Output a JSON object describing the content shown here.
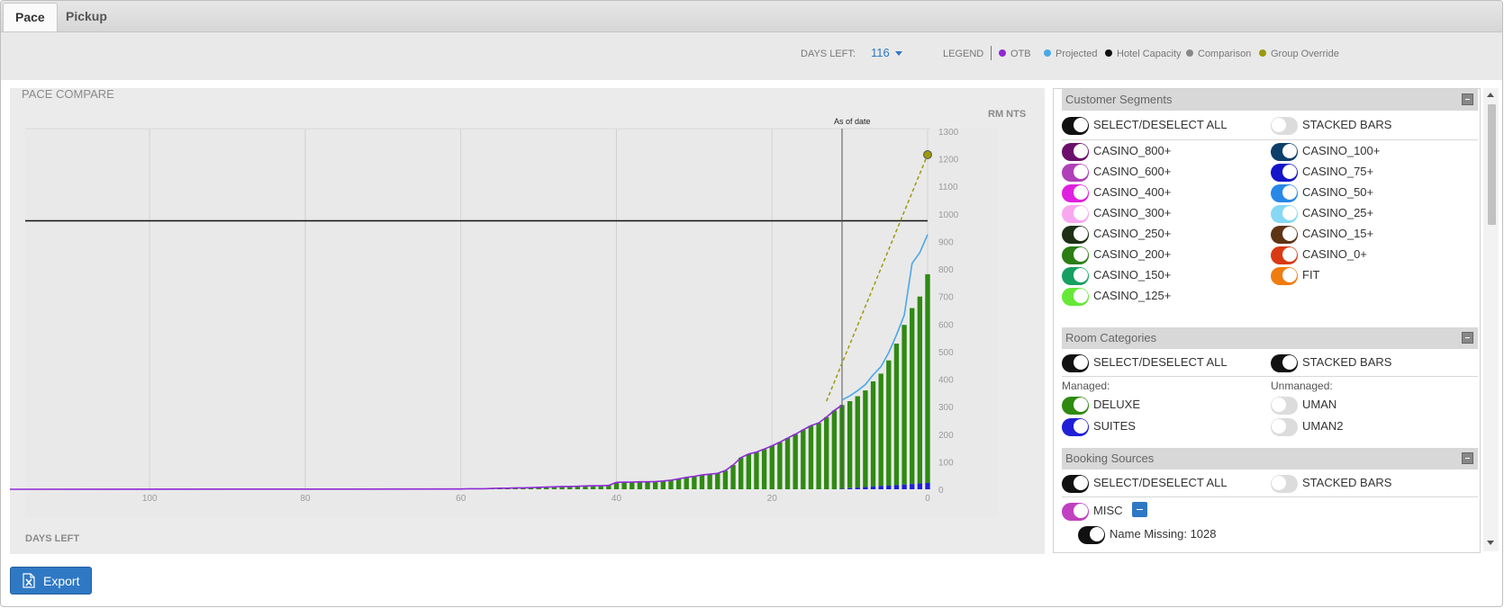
{
  "tabs": {
    "pace": "Pace",
    "pickup": "Pickup"
  },
  "toolbar": {
    "days_left_label": "DAYS LEFT:",
    "days_left_value": "116",
    "legend_label": "LEGEND",
    "legend": [
      {
        "label": "OTB",
        "color": "#8e2ad6"
      },
      {
        "label": "Projected",
        "color": "#4aa8e8"
      },
      {
        "label": "Hotel Capacity",
        "color": "#111111"
      },
      {
        "label": "Comparison",
        "color": "#888888"
      },
      {
        "label": "Group Override",
        "color": "#9a9a0a"
      }
    ]
  },
  "chart": {
    "title": "PACE COMPARE",
    "ylabel": "RM NTS",
    "xlabel": "DAYS LEFT",
    "as_of_label": "As of date"
  },
  "chart_data": {
    "type": "bar",
    "title": "PACE COMPARE",
    "xlabel": "DAYS LEFT",
    "ylabel": "RM NTS",
    "xlim": [
      116,
      0
    ],
    "ylim": [
      0,
      1300
    ],
    "x_ticks": [
      100,
      80,
      60,
      40,
      20,
      0
    ],
    "y_ticks": [
      0,
      100,
      200,
      300,
      400,
      500,
      600,
      700,
      800,
      900,
      1000,
      1100,
      1200,
      1300
    ],
    "grid": true,
    "as_of_days_left": 11,
    "hotel_capacity": 975,
    "group_override_end": 1215,
    "days_left": [
      61,
      60,
      59,
      58,
      57,
      56,
      55,
      54,
      53,
      52,
      51,
      50,
      49,
      48,
      47,
      46,
      45,
      44,
      43,
      42,
      41,
      40,
      39,
      38,
      37,
      36,
      35,
      34,
      33,
      32,
      31,
      30,
      29,
      28,
      27,
      26,
      25,
      24,
      23,
      22,
      21,
      20,
      19,
      18,
      17,
      16,
      15,
      14,
      13,
      12,
      11,
      10,
      9,
      8,
      7,
      6,
      5,
      4,
      3,
      2,
      1,
      0
    ],
    "otb": [
      1,
      1,
      2,
      2,
      2,
      3,
      4,
      4,
      5,
      5,
      6,
      7,
      8,
      9,
      10,
      10,
      11,
      12,
      13,
      13,
      14,
      25,
      26,
      26,
      27,
      27,
      28,
      30,
      33,
      38,
      43,
      47,
      52,
      55,
      58,
      68,
      88,
      115,
      128,
      135,
      146,
      158,
      171,
      186,
      200,
      216,
      231,
      241,
      262,
      286,
      306,
      320,
      338,
      359,
      392,
      420,
      468,
      529,
      597,
      658,
      700,
      781
    ],
    "projected_tail": [
      820,
      860,
      925
    ],
    "group_override": [
      [
        13,
        320
      ],
      [
        0,
        1215
      ]
    ],
    "series": [
      {
        "name": "DELUXE",
        "color": "#2f8a12"
      },
      {
        "name": "SUITES",
        "color": "#1f1fd8"
      }
    ]
  },
  "sections": {
    "customer_segments": {
      "title": "Customer Segments",
      "select_all": "SELECT/DESELECT ALL",
      "stacked": "STACKED BARS",
      "items": [
        {
          "label": "CASINO_800+",
          "color": "#6b0f6b"
        },
        {
          "label": "CASINO_100+",
          "color": "#0d3f6b"
        },
        {
          "label": "CASINO_600+",
          "color": "#b040b8"
        },
        {
          "label": "CASINO_75+",
          "color": "#1414c8"
        },
        {
          "label": "CASINO_400+",
          "color": "#e020e0"
        },
        {
          "label": "CASINO_50+",
          "color": "#2888e8"
        },
        {
          "label": "CASINO_300+",
          "color": "#f8a8f0"
        },
        {
          "label": "CASINO_25+",
          "color": "#86d8f4"
        },
        {
          "label": "CASINO_250+",
          "color": "#1d3014"
        },
        {
          "label": "CASINO_15+",
          "color": "#5e3414"
        },
        {
          "label": "CASINO_200+",
          "color": "#2c7d14"
        },
        {
          "label": "CASINO_0+",
          "color": "#d83a14"
        },
        {
          "label": "CASINO_150+",
          "color": "#17a062"
        },
        {
          "label": "FIT",
          "color": "#f07c10"
        },
        {
          "label": "CASINO_125+",
          "color": "#66e838"
        }
      ]
    },
    "room_categories": {
      "title": "Room Categories",
      "select_all": "SELECT/DESELECT ALL",
      "stacked": "STACKED BARS",
      "managed_label": "Managed:",
      "unmanaged_label": "Unmanaged:",
      "managed": [
        {
          "label": "DELUXE",
          "color": "#2f8a12"
        },
        {
          "label": "SUITES",
          "color": "#1f1fd8"
        }
      ],
      "unmanaged": [
        {
          "label": "UMAN"
        },
        {
          "label": "UMAN2"
        }
      ]
    },
    "booking_sources": {
      "title": "Booking Sources",
      "select_all": "SELECT/DESELECT ALL",
      "stacked": "STACKED BARS",
      "misc": {
        "label": "MISC",
        "color": "#c040c0"
      },
      "name_missing": "Name Missing: 1028"
    }
  },
  "export": {
    "label": "Export"
  }
}
